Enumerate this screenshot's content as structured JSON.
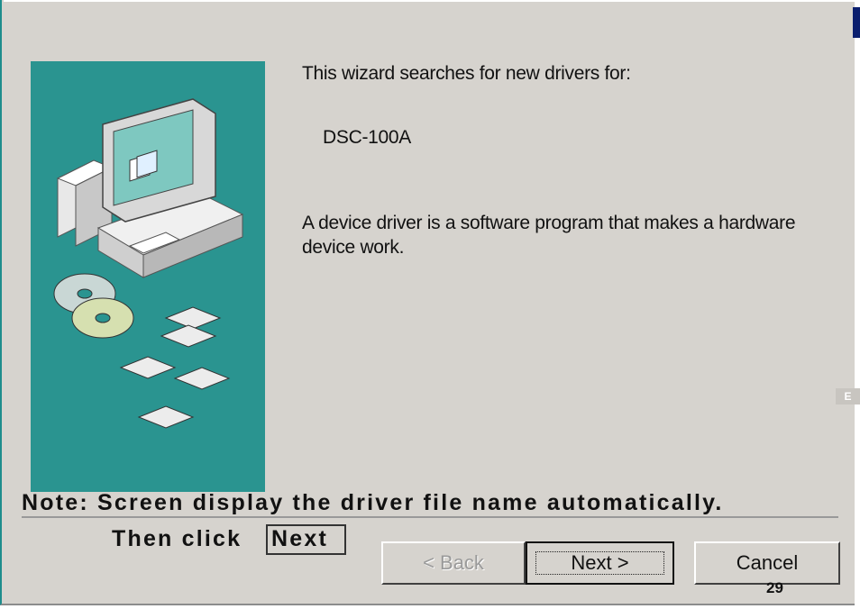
{
  "dialog": {
    "intro_text": "This wizard searches for new drivers for:",
    "device_name": "DSC-100A",
    "description": "A device driver is a software program that makes a hardware device work."
  },
  "annotation": {
    "note": "Note: Screen display the driver file name automatically.",
    "then_click": "Then click",
    "next_label": "Next"
  },
  "buttons": {
    "back": "< Back",
    "next": "Next >",
    "cancel": "Cancel"
  },
  "page": {
    "language_tab": "E",
    "page_number": "29"
  },
  "colors": {
    "dialog_bg": "#d6d3ce",
    "side_panel": "#2a9490",
    "title_strip": "#0a1e6e"
  },
  "icons": [
    "computer-illustration-icon",
    "cd-disc-icon",
    "floppy-disk-icon"
  ]
}
